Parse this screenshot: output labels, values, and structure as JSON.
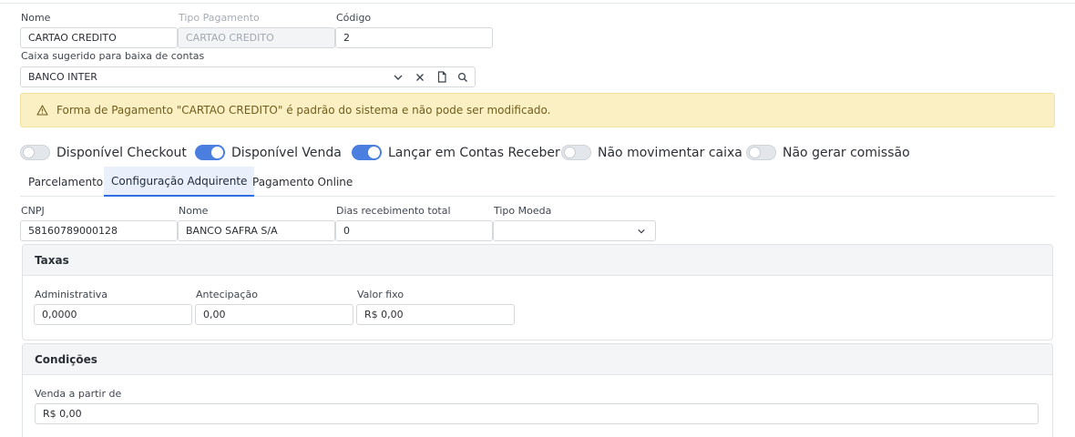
{
  "form": {
    "nome": {
      "label": "Nome",
      "value": "CARTAO CREDITO"
    },
    "tipo_pagamento": {
      "label": "Tipo Pagamento",
      "value": "CARTAO CREDITO"
    },
    "codigo": {
      "label": "Código",
      "value": "2"
    },
    "caixa": {
      "label": "Caixa sugerido para baixa de contas",
      "value": "BANCO INTER",
      "icons": [
        "chevron-down-icon",
        "close-icon",
        "document-icon",
        "search-icon"
      ]
    }
  },
  "alert": {
    "icon": "warning-icon",
    "text": "Forma de Pagamento \"CARTAO CREDITO\" é padrão do sistema e não pode ser modificado.",
    "background": "#fbf0c4"
  },
  "toggles": [
    {
      "label": "Disponível Checkout",
      "on": false
    },
    {
      "label": "Disponível Venda",
      "on": true
    },
    {
      "label": "Lançar em Contas Receber",
      "on": true
    },
    {
      "label": "Não movimentar caixa",
      "on": false
    },
    {
      "label": "Não gerar comissão",
      "on": false
    }
  ],
  "accent_color": "#4a7fe0",
  "tabs": [
    {
      "label": "Parcelamento",
      "active": false
    },
    {
      "label": "Configuração Adquirente",
      "active": true
    },
    {
      "label": "Pagamento Online",
      "active": false
    }
  ],
  "adquirente": {
    "cnpj": {
      "label": "CNPJ",
      "value": "58160789000128"
    },
    "nome": {
      "label": "Nome",
      "value": "BANCO SAFRA S/A"
    },
    "dias": {
      "label": "Dias recebimento total",
      "value": "0"
    },
    "moeda": {
      "label": "Tipo Moeda",
      "value": ""
    }
  },
  "taxas": {
    "title": "Taxas",
    "administrativa": {
      "label": "Administrativa",
      "value": "0,0000"
    },
    "antecipacao": {
      "label": "Antecipação",
      "value": "0,00"
    },
    "valor_fixo": {
      "label": "Valor fixo",
      "value": "R$ 0,00"
    }
  },
  "condicoes": {
    "title": "Condições",
    "venda_a_partir": {
      "label": "Venda a partir de",
      "value": "R$ 0,00"
    }
  }
}
